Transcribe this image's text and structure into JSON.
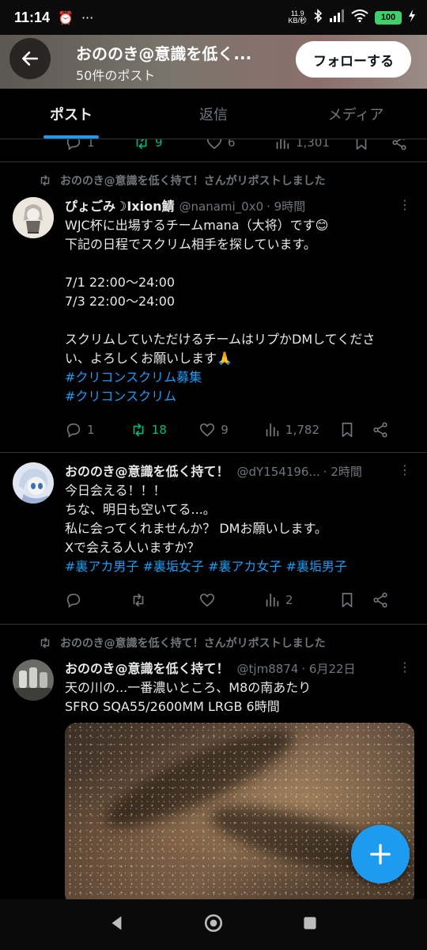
{
  "status_bar": {
    "time": "11:14",
    "alarm_icon": "alarm-icon",
    "more_icon": "ellipsis",
    "net_speed_value": "11.9",
    "net_speed_unit": "KB/秒",
    "battery": "100"
  },
  "header": {
    "title": "おののき@意識を低く...",
    "post_count": "50件のポスト",
    "follow_label": "フォローする"
  },
  "tabs": [
    {
      "label": "ポスト",
      "active": true
    },
    {
      "label": "返信",
      "active": false
    },
    {
      "label": "メディア",
      "active": false
    }
  ],
  "top_partial": {
    "replies": "1",
    "reposts": "9",
    "likes": "6",
    "views": "1,301"
  },
  "tweets": [
    {
      "repost_label": "おののき@意識を低く持て！さんがリポストしました",
      "name": "ぴょごみ☽Ixion鯖",
      "handle": "@nanami_0x0",
      "time": "· 9時間",
      "lines": [
        "WJC杯に出場するチームmana（大将）です😊",
        "下記の日程でスクリム相手を探しています。",
        "",
        "7/1 22:00～24:00",
        "7/3 22:00～24:00",
        "",
        "スクリムしていただけるチームはリプかDMしてくださ",
        "い、よろしくお願いします🙏"
      ],
      "hashtags": [
        "#クリコンスクリム募集",
        "#クリコンスクリム"
      ],
      "replies": "1",
      "reposts": "18",
      "likes": "9",
      "views": "1,782"
    },
    {
      "name": "おののき@意識を低く持て！",
      "handle": "@dY154196...",
      "time": "· 2時間",
      "lines": [
        "今日会える！！！",
        "ちな、明日も空いてる...。",
        "私に会ってくれませんか？ DMお願いします。",
        "Xで会える人いますか？"
      ],
      "hashtag_line": "#裏アカ男子 #裏垢女子 #裏アカ女子 #裏垢男子",
      "replies": "",
      "reposts": "",
      "likes": "",
      "views": "2"
    },
    {
      "repost_label": "おののき@意識を低く持て！さんがリポストしました",
      "name": "おののき@意識を低く持て！",
      "handle": "@tjm8874",
      "time": "· 6月22日",
      "lines": [
        "天の川の...一番濃いところ、M8の南あたり",
        "SFRO SQA55/2600MM LRGB 6時間"
      ]
    }
  ],
  "colors": {
    "accent": "#1d9bf0",
    "repost_green": "#00ba7c",
    "muted": "#71767b"
  }
}
